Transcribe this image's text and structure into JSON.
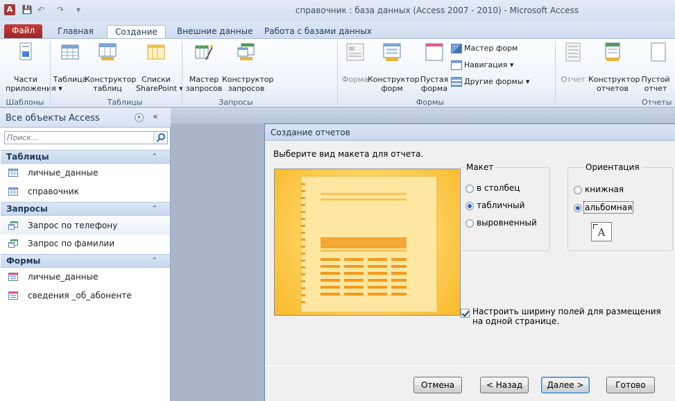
{
  "window": {
    "title": "справочник : база данных (Access 2007 - 2010)  -  Microsoft Access",
    "logo_letter": "A",
    "quick_access": {
      "save": "💾",
      "undo": "↶",
      "redo": "↷",
      "customize": "▾"
    }
  },
  "ribbon_tabs": [
    "Файл",
    "Главная",
    "Создание",
    "Внешние данные",
    "Работа с базами данных"
  ],
  "active_tab": "Создание",
  "ribbon": {
    "templates": {
      "app_parts": [
        "Части",
        "приложения ▾"
      ],
      "group": "Шаблоны"
    },
    "tables": {
      "table": "Таблица",
      "table_design": [
        "Конструктор",
        "таблиц"
      ],
      "sharepoint": [
        "Списки",
        "SharePoint ▾"
      ],
      "group": "Таблицы"
    },
    "queries": {
      "wizard": [
        "Мастер",
        "запросов"
      ],
      "design": [
        "Конструктор",
        "запросов"
      ],
      "group": "Запросы"
    },
    "forms": {
      "form": "Форма",
      "design": [
        "Конструктор",
        "форм"
      ],
      "blank": [
        "Пустая",
        "форма"
      ],
      "wizard": "Мастер форм",
      "navigation": "Навигация ▾",
      "more": "Другие формы ▾",
      "group": "Формы"
    },
    "reports": {
      "report": "Отчет",
      "design": [
        "Конструктор",
        "отчетов"
      ],
      "blank": [
        "Пустой",
        "отчет"
      ],
      "group": "Отчеты"
    }
  },
  "nav": {
    "title": "Все объекты Access",
    "dropdown_icon": "▾",
    "collapse_icon": "«",
    "search_placeholder": "Поиск...",
    "groups": [
      {
        "title": "Таблицы",
        "items": [
          "личные_данные",
          "справочник"
        ]
      },
      {
        "title": "Запросы",
        "items": [
          "Запрос по телефону",
          "Запрос по фамилии"
        ]
      },
      {
        "title": "Формы",
        "items": [
          "личные_данные",
          "сведения _об_абоненте"
        ]
      }
    ],
    "group_chevron": "⌃"
  },
  "dialog": {
    "title": "Создание отчетов",
    "prompt": "Выберите вид макета для отчета.",
    "layout": {
      "legend": "Макет",
      "options": [
        "в столбец",
        "табличный",
        "выровненный"
      ],
      "selected": "табличный"
    },
    "orientation": {
      "legend": "Ориентация",
      "options": [
        "книжная",
        "альбомная"
      ],
      "selected": "альбомная",
      "preview_letter": "A"
    },
    "fit_fields": {
      "label": "Настроить ширину полей для размещения на одной странице.",
      "checked": true
    },
    "buttons": {
      "cancel": "Отмена",
      "back": "< Назад",
      "next": "Далее >",
      "finish": "Готово"
    }
  },
  "colors": {
    "file_tab": "#b03030",
    "preview_bg": "#ffd463",
    "selection": "#2c63c5"
  }
}
